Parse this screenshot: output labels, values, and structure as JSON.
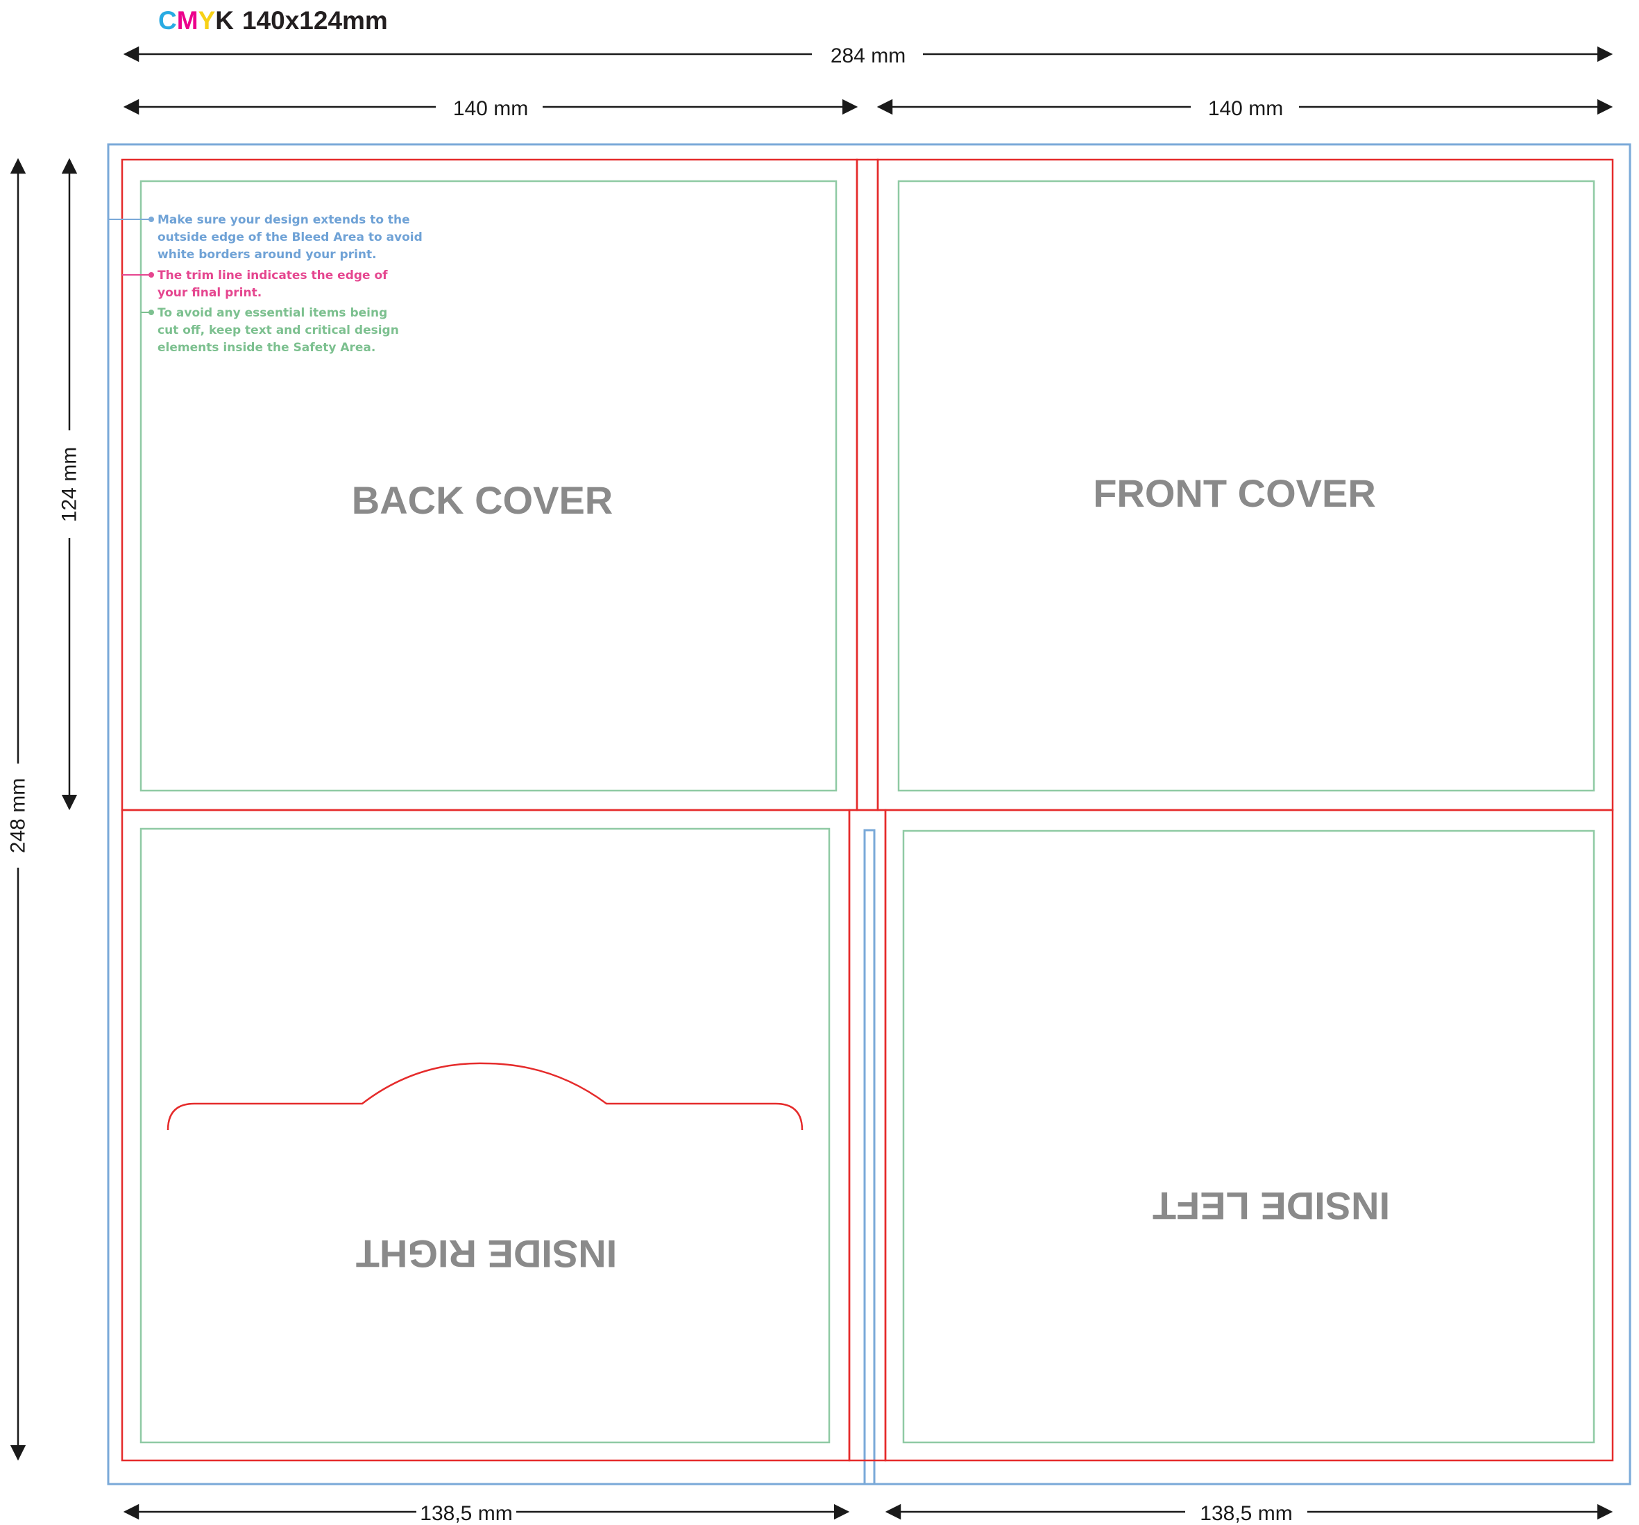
{
  "header": {
    "letters": [
      {
        "char": "C",
        "color": "#29abe2"
      },
      {
        "char": "M",
        "color": "#ec008c"
      },
      {
        "char": "Y",
        "color": "#f7d117"
      },
      {
        "char": "K",
        "color": "#231f20"
      }
    ],
    "size_label": "140x124mm"
  },
  "dimensions": {
    "total_width": "284 mm",
    "half_width_left": "140 mm",
    "half_width_right": "140 mm",
    "total_height": "248 mm",
    "half_height": "124 mm",
    "bottom_left": "138,5 mm",
    "bottom_right": "138,5 mm"
  },
  "notes": {
    "bleed": [
      "Make sure your design extends to the",
      "outside edge of the Bleed Area to avoid",
      "white borders around your print."
    ],
    "trim": [
      "The trim line indicates the edge of",
      "your final print."
    ],
    "safety": [
      "To avoid any essential items being",
      "cut off, keep text and critical design",
      "elements inside the Safety Area."
    ]
  },
  "panels": {
    "back_cover": "BACK COVER",
    "front_cover": "FRONT COVER",
    "inside_right": "INSIDE RIGHT",
    "inside_left": "INSIDE LEFT"
  },
  "colors": {
    "bleed": "#7aa9d8",
    "trim": "#e52b2b",
    "safety": "#8fcaa4",
    "bleed_note": "#6fa2d6",
    "trim_note": "#e5468f",
    "safety_note": "#7cc08f",
    "dimension": "#1a1a1a",
    "panel_text": "#8a8a8a"
  }
}
